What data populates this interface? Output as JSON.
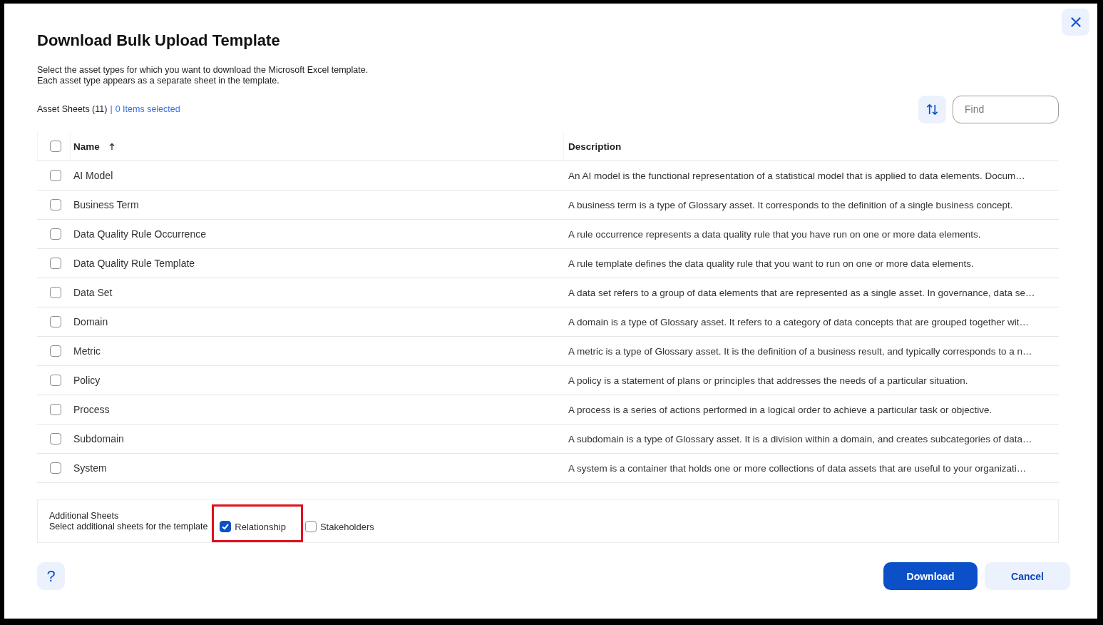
{
  "dialog": {
    "title": "Download Bulk Upload Template",
    "description_lines": [
      "Select the asset types for which you want to download the Microsoft Excel template.",
      "Each asset type appears as a separate sheet in the template."
    ]
  },
  "toolbar": {
    "count_label": "Asset Sheets (11)",
    "separator": "|",
    "selection_label": "0 Items selected",
    "search": {
      "placeholder": "Find"
    }
  },
  "table": {
    "select_all": {
      "checked": false
    },
    "columns": [
      {
        "label": "Name",
        "sorted": true
      },
      {
        "label": "Description",
        "sorted": false
      }
    ],
    "rows": [
      {
        "name": "AI Model",
        "description": "An AI model is the functional representation of a statistical model that is applied to data elements. Docum…",
        "checked": false
      },
      {
        "name": "Business Term",
        "description": "A business term is a type of Glossary asset. It corresponds to the definition of a single business concept.",
        "checked": false
      },
      {
        "name": "Data Quality Rule Occurrence",
        "description": "A rule occurrence represents a data quality rule that you have run on one or more data elements.",
        "checked": false
      },
      {
        "name": "Data Quality Rule Template",
        "description": "A rule template defines the data quality rule that you want to run on one or more data elements.",
        "checked": false
      },
      {
        "name": "Data Set",
        "description": "A data set refers to a group of data elements that are represented as a single asset. In governance, data se…",
        "checked": false
      },
      {
        "name": "Domain",
        "description": "A domain is a type of Glossary asset. It refers to a category of data concepts that are grouped together wit…",
        "checked": false
      },
      {
        "name": "Metric",
        "description": "A metric is a type of Glossary asset. It is the definition of a business result, and typically corresponds to a n…",
        "checked": false
      },
      {
        "name": "Policy",
        "description": "A policy is a statement of plans or principles that addresses the needs of a particular situation.",
        "checked": false
      },
      {
        "name": "Process",
        "description": "A process is a series of actions performed in a logical order to achieve a particular task or objective.",
        "checked": false
      },
      {
        "name": "Subdomain",
        "description": "A subdomain is a type of Glossary asset. It is a division within a domain, and creates subcategories of data…",
        "checked": false
      },
      {
        "name": "System",
        "description": "A system is a container that holds one or more collections of data assets that are useful to your organizati…",
        "checked": false
      }
    ]
  },
  "additional_sheets": {
    "title": "Additional Sheets",
    "subtitle": "Select additional sheets for the template",
    "options": [
      {
        "label": "Relationship",
        "checked": true,
        "highlighted": true
      },
      {
        "label": "Stakeholders",
        "checked": false,
        "highlighted": false
      }
    ]
  },
  "footer": {
    "help_button": {
      "label": "?"
    },
    "buttons": [
      {
        "label": "Download",
        "kind": "primary"
      },
      {
        "label": "Cancel",
        "kind": "secondary"
      }
    ]
  }
}
